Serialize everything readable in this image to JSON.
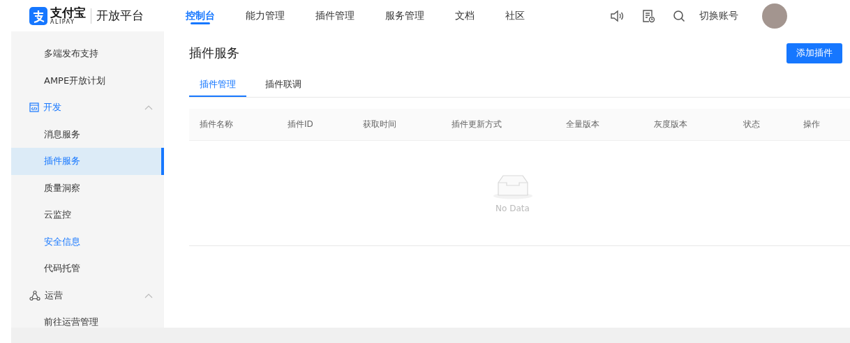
{
  "header": {
    "logo": {
      "name": "支付宝",
      "subtitle": "ALIPAY"
    },
    "product": "开放平台",
    "nav": [
      {
        "label": "控制台",
        "selected": true
      },
      {
        "label": "能力管理",
        "selected": false
      },
      {
        "label": "插件管理",
        "selected": false
      },
      {
        "label": "服务管理",
        "selected": false
      },
      {
        "label": "文档",
        "selected": false
      },
      {
        "label": "社区",
        "selected": false
      }
    ],
    "switch_account": "切换账号"
  },
  "sidebar": {
    "items": [
      {
        "kind": "item",
        "label": "多端发布支持",
        "selected": false,
        "highlighted": false
      },
      {
        "kind": "item",
        "label": "AMPE开放计划",
        "selected": false,
        "highlighted": false
      },
      {
        "kind": "group",
        "label": "开发",
        "expanded": true,
        "active": true
      },
      {
        "kind": "item",
        "label": "消息服务",
        "selected": false,
        "highlighted": false
      },
      {
        "kind": "item",
        "label": "插件服务",
        "selected": true,
        "highlighted": false
      },
      {
        "kind": "item",
        "label": "质量洞察",
        "selected": false,
        "highlighted": false
      },
      {
        "kind": "item",
        "label": "云监控",
        "selected": false,
        "highlighted": false
      },
      {
        "kind": "item",
        "label": "安全信息",
        "selected": false,
        "highlighted": true
      },
      {
        "kind": "item",
        "label": "代码托管",
        "selected": false,
        "highlighted": false
      },
      {
        "kind": "group",
        "label": "运营",
        "expanded": true,
        "active": false
      },
      {
        "kind": "item",
        "label": "前往运营管理",
        "selected": false,
        "highlighted": false
      }
    ]
  },
  "page": {
    "title": "插件服务",
    "add_button": "添加插件",
    "tabs": [
      {
        "label": "插件管理",
        "selected": true
      },
      {
        "label": "插件联调",
        "selected": false
      }
    ],
    "table": {
      "columns": [
        "插件名称",
        "插件ID",
        "获取时间",
        "插件更新方式",
        "全量版本",
        "灰度版本",
        "状态",
        "操作"
      ],
      "empty_text": "No Data"
    }
  }
}
